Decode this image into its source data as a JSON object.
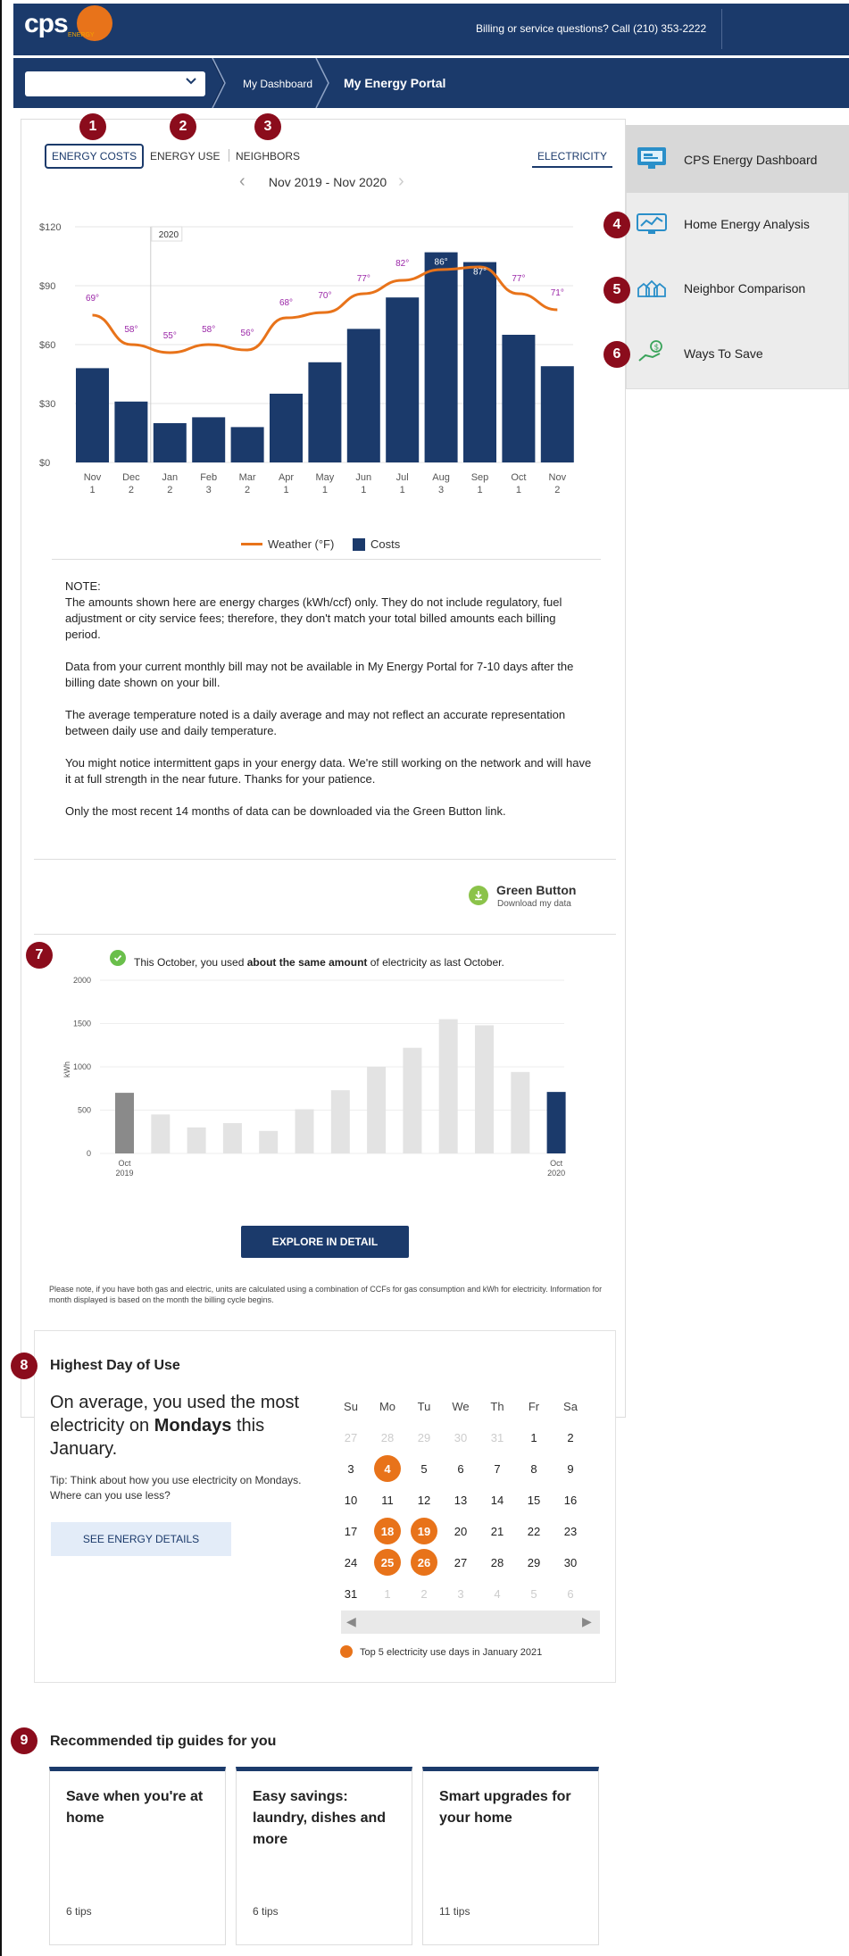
{
  "header": {
    "logo": "cps",
    "logo_sub": "ENERGY",
    "help_text": "Billing or service questions? Call (210) 353-2222"
  },
  "nav": {
    "select_value": "",
    "breadcrumbs": [
      "My Dashboard",
      "My Energy Portal"
    ]
  },
  "tabs": {
    "energy_costs": "ENERGY COSTS",
    "energy_use": "ENERGY USE",
    "neighbors": "NEIGHBORS",
    "electricity": "ELECTRICITY"
  },
  "badges": [
    "1",
    "2",
    "3",
    "4",
    "5",
    "6",
    "7",
    "8",
    "9"
  ],
  "period": "Nov 2019 - Nov 2020",
  "chart_data": [
    {
      "type": "bar",
      "title": "",
      "categories": [
        "Nov 1",
        "Dec 2",
        "Jan 2",
        "Feb 3",
        "Mar 2",
        "Apr 1",
        "May 1",
        "Jun 1",
        "Jul 1",
        "Aug 3",
        "Sep 1",
        "Oct 1",
        "Nov 2"
      ],
      "category_lines": [
        [
          "Nov",
          "1"
        ],
        [
          "Dec",
          "2"
        ],
        [
          "Jan",
          "2"
        ],
        [
          "Feb",
          "3"
        ],
        [
          "Mar",
          "2"
        ],
        [
          "Apr",
          "1"
        ],
        [
          "May",
          "1"
        ],
        [
          "Jun",
          "1"
        ],
        [
          "Jul",
          "1"
        ],
        [
          "Aug",
          "3"
        ],
        [
          "Sep",
          "1"
        ],
        [
          "Oct",
          "1"
        ],
        [
          "Nov",
          "2"
        ]
      ],
      "series": [
        {
          "name": "Costs",
          "values": [
            48,
            31,
            20,
            23,
            18,
            35,
            51,
            68,
            84,
            107,
            102,
            65,
            49
          ],
          "color": "#1b3a6b"
        },
        {
          "name": "Weather (°F)",
          "values": [
            69,
            58,
            55,
            58,
            56,
            68,
            70,
            77,
            82,
            86,
            87,
            77,
            71
          ],
          "color": "#e8731a"
        }
      ],
      "temp_labels": [
        "69°",
        "58°",
        "55°",
        "58°",
        "56°",
        "68°",
        "70°",
        "77°",
        "82°",
        "86°",
        "87°",
        "77°",
        "71°"
      ],
      "yticks": [
        "$0",
        "$30",
        "$60",
        "$90",
        "$120"
      ],
      "ylim": [
        0,
        120
      ],
      "marker_label": "2020",
      "legend": {
        "weather": "Weather (°F)",
        "costs": "Costs"
      }
    },
    {
      "type": "bar",
      "title": "",
      "ylabel": "kWh",
      "ylim": [
        0,
        2000
      ],
      "yticks": [
        "0",
        "500",
        "1000",
        "1500",
        "2000"
      ],
      "values": [
        700,
        450,
        300,
        350,
        260,
        510,
        730,
        1000,
        1220,
        1550,
        1480,
        940,
        710
      ],
      "x_first": [
        "Oct",
        "2019"
      ],
      "x_last": [
        "Oct",
        "2020"
      ],
      "colors": {
        "first": "#8a8a8a",
        "middle": "#e3e3e3",
        "last": "#1b3a6b"
      }
    }
  ],
  "note": {
    "heading": "NOTE:",
    "p1": "The amounts shown here are energy charges (kWh/ccf) only. They do not include regulatory, fuel adjustment or city service fees; therefore, they don't match your total billed amounts each billing period.",
    "p2": "Data from your current monthly bill may not be available in My Energy Portal for 7-10 days after the billing date shown on your bill.",
    "p3": "The average temperature noted is a daily average and may not reflect an accurate representation between daily use and daily temperature.",
    "p4": "You might notice intermittent gaps in your energy data. We're still working on the network and will have it at full strength in the near future. Thanks for your patience.",
    "p5": "Only the most recent 14 months of data can be downloaded via the Green Button link."
  },
  "green_button": {
    "title": "Green Button",
    "subtitle": "Download my data"
  },
  "comparison": {
    "pre": "This October, you used ",
    "bold": "about the same amount",
    "post": " of electricity as last October."
  },
  "explore_button": "EXPLORE IN DETAIL",
  "units_note": "Please note, if you have both gas and electric, units are calculated using a combination of CCFs for gas consumption and kWh for electricity. Information for month displayed is based on the month the billing cycle begins.",
  "highest_day": {
    "title": "Highest Day of Use",
    "main_pre": "On average, you used the most electricity on ",
    "main_bold": "Mondays",
    "main_post": " this January.",
    "tip": "Tip: Think about how you use electricity on Mondays. Where can you use less?",
    "button": "SEE ENERGY DETAILS",
    "weekdays": [
      "Su",
      "Mo",
      "Tu",
      "We",
      "Th",
      "Fr",
      "Sa"
    ],
    "weeks": [
      [
        "27",
        "28",
        "29",
        "30",
        "31",
        "1",
        "2"
      ],
      [
        "3",
        "4",
        "5",
        "6",
        "7",
        "8",
        "9"
      ],
      [
        "10",
        "11",
        "12",
        "13",
        "14",
        "15",
        "16"
      ],
      [
        "17",
        "18",
        "19",
        "20",
        "21",
        "22",
        "23"
      ],
      [
        "24",
        "25",
        "26",
        "27",
        "28",
        "29",
        "30"
      ],
      [
        "31",
        "1",
        "2",
        "3",
        "4",
        "5",
        "6"
      ]
    ],
    "top_days": [
      "4",
      "18",
      "19",
      "25",
      "26"
    ],
    "legend": "Top 5 electricity use days in January 2021"
  },
  "tips": {
    "title": "Recommended tip guides for you",
    "cards": [
      {
        "title": "Save when you're at home",
        "count": "6 tips"
      },
      {
        "title": "Easy savings: laundry, dishes and more",
        "count": "6 tips"
      },
      {
        "title": "Smart upgrades for your home",
        "count": "11 tips"
      }
    ]
  },
  "sidebar": {
    "items": [
      {
        "label": "CPS Energy Dashboard",
        "icon": "dashboard-icon"
      },
      {
        "label": "Home Energy Analysis",
        "icon": "home-analysis-icon"
      },
      {
        "label": "Neighbor Comparison",
        "icon": "neighbors-icon"
      },
      {
        "label": "Ways To Save",
        "icon": "savings-icon"
      }
    ]
  }
}
